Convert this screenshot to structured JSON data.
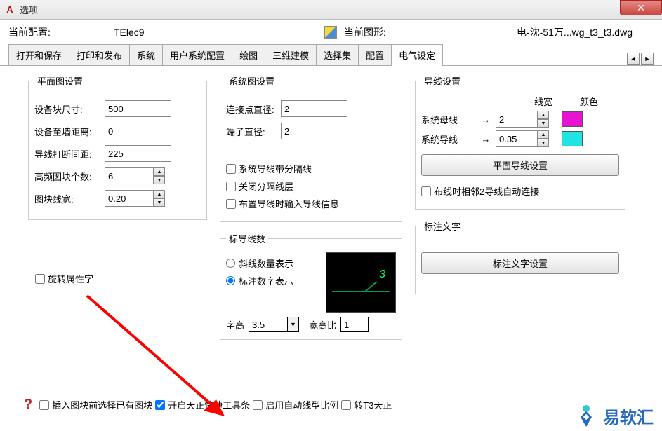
{
  "window": {
    "title": "选项"
  },
  "header": {
    "label1": "当前配置:",
    "value1": "TElec9",
    "label2": "当前图形:",
    "value2": "电-沈-51万...wg_t3_t3.dwg"
  },
  "tabs": {
    "items": [
      "打开和保存",
      "打印和发布",
      "系统",
      "用户系统配置",
      "绘图",
      "三维建模",
      "选择集",
      "配置",
      "电气设定"
    ],
    "active": 8
  },
  "plane": {
    "legend": "平面图设置",
    "block_size_label": "设备块尺寸:",
    "block_size": "500",
    "wall_dist_label": "设备至墙距离:",
    "wall_dist": "0",
    "break_gap_label": "导线打断间距:",
    "break_gap": "225",
    "hf_count_label": "高频图块个数:",
    "hf_count": "6",
    "block_lw_label": "图块线宽:",
    "block_lw": "0.20",
    "rotate_attr": "旋转属性字"
  },
  "system": {
    "legend": "系统图设置",
    "conn_diam_label": "连接点直径:",
    "conn_diam": "2",
    "term_diam_label": "端子直径:",
    "term_diam": "2",
    "chk1": "系统导线带分隔线",
    "chk2": "关闭分隔线层",
    "chk3": "布置导线时输入导线信息"
  },
  "wire": {
    "legend": "导线设置",
    "h_width": "线宽",
    "h_color": "颜色",
    "r1_label": "系统母线",
    "r1_width": "2",
    "r2_label": "系统导线",
    "r2_width": "0.35",
    "colors": {
      "r1": "#e613d1",
      "r2": "#22e3e3"
    },
    "button": "平面导线设置",
    "auto_connect": "布线时相邻2导线自动连接"
  },
  "leader": {
    "legend": "标导线数",
    "opt1": "斜线数量表示",
    "opt2": "标注数字表示",
    "height_label": "字高",
    "height": "3.5",
    "ratio_label": "宽高比",
    "ratio": "1"
  },
  "label": {
    "legend": "标注文字",
    "button": "标注文字设置"
  },
  "bottom": {
    "chk1": "插入图块前选择已有图块",
    "chk2": "开启天正快捷工具条",
    "chk3": "启用自动线型比例",
    "chk4": "转T3天正"
  },
  "watermark": "易软汇"
}
